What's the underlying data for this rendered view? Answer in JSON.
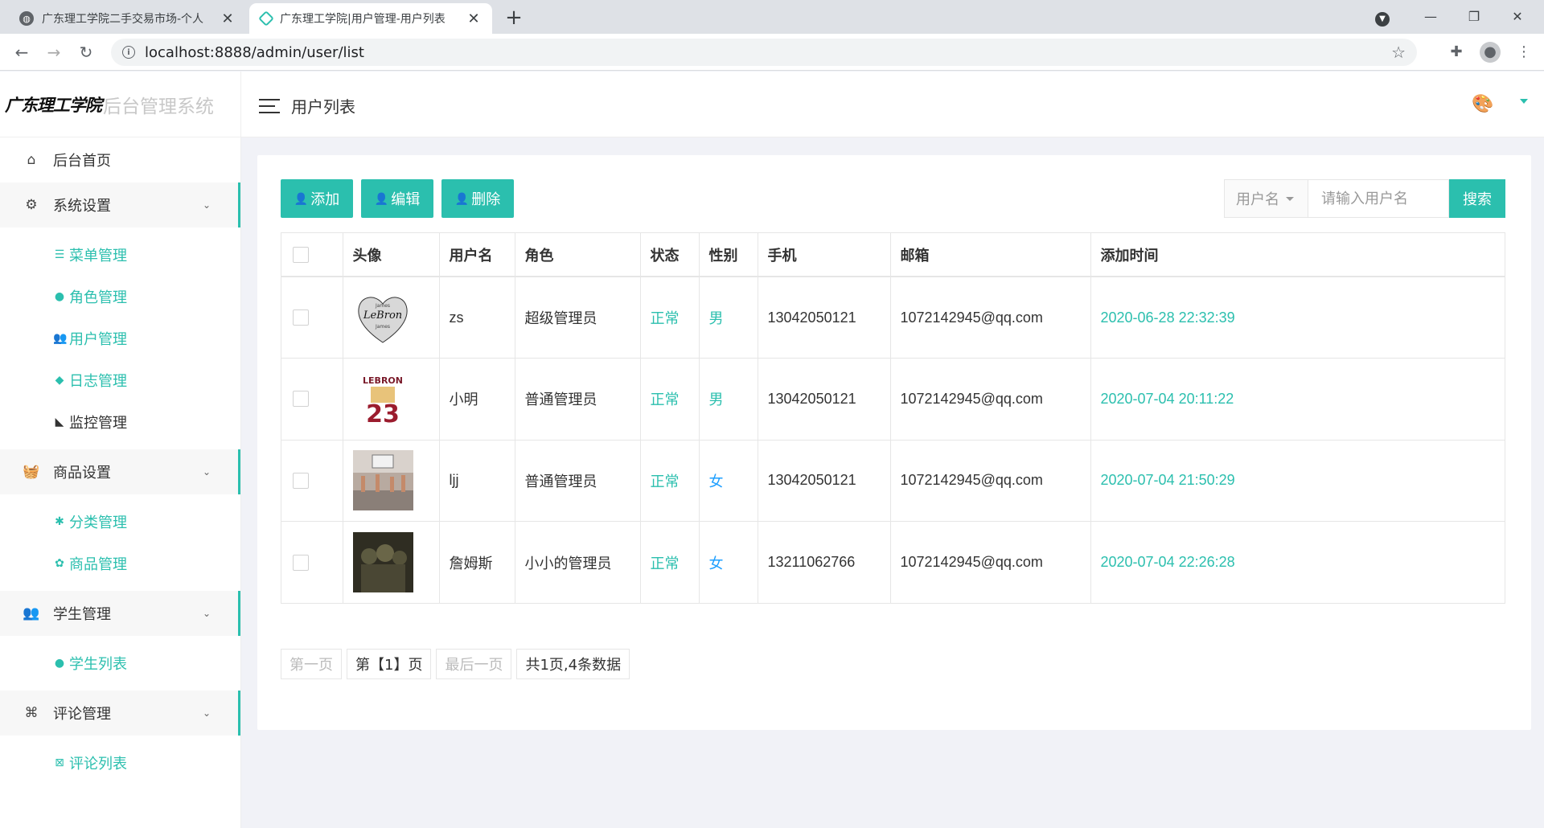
{
  "browser": {
    "tabs": [
      {
        "title": "广东理工学院二手交易市场-个人"
      },
      {
        "title": "广东理工学院|用户管理-用户列表"
      }
    ],
    "url": "localhost:8888/admin/user/list"
  },
  "sidebar": {
    "logo_school": "广东理工学院",
    "logo_system": "后台管理系统",
    "home": "后台首页",
    "groups": [
      {
        "label": "系统设置",
        "items": [
          "菜单管理",
          "角色管理",
          "用户管理",
          "日志管理",
          "监控管理"
        ]
      },
      {
        "label": "商品设置",
        "items": [
          "分类管理",
          "商品管理"
        ]
      },
      {
        "label": "学生管理",
        "items": [
          "学生列表"
        ]
      },
      {
        "label": "评论管理",
        "items": [
          "评论列表"
        ]
      }
    ]
  },
  "header": {
    "title": "用户列表"
  },
  "toolbar": {
    "add_label": "添加",
    "edit_label": "编辑",
    "delete_label": "删除",
    "search_field": "用户名",
    "search_placeholder": "请输入用户名",
    "search_label": "搜索"
  },
  "table": {
    "columns": [
      "头像",
      "用户名",
      "角色",
      "状态",
      "性别",
      "手机",
      "邮箱",
      "添加时间"
    ],
    "rows": [
      {
        "username": "zs",
        "role": "超级管理员",
        "status": "正常",
        "gender": "男",
        "phone": "13042050121",
        "email": "1072142945@qq.com",
        "created": "2020-06-28 22:32:39"
      },
      {
        "username": "小明",
        "role": "普通管理员",
        "status": "正常",
        "gender": "男",
        "phone": "13042050121",
        "email": "1072142945@qq.com",
        "created": "2020-07-04 20:11:22"
      },
      {
        "username": "ljj",
        "role": "普通管理员",
        "status": "正常",
        "gender": "女",
        "phone": "13042050121",
        "email": "1072142945@qq.com",
        "created": "2020-07-04 21:50:29"
      },
      {
        "username": "詹姆斯",
        "role": "小小的管理员",
        "status": "正常",
        "gender": "女",
        "phone": "13211062766",
        "email": "1072142945@qq.com",
        "created": "2020-07-04 22:26:28"
      }
    ]
  },
  "pager": {
    "first": "第一页",
    "current": "第【1】页",
    "last": "最后一页",
    "summary": "共1页,4条数据"
  },
  "colors": {
    "accent": "#2bbfae",
    "female": "#1e9fff"
  }
}
